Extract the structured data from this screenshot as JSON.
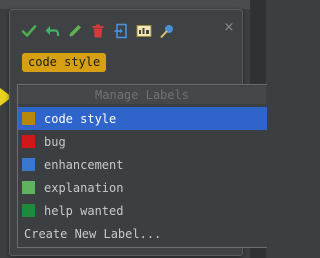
{
  "toolbar": {
    "icons": [
      {
        "name": "checkmark-icon",
        "color": "#4caf50"
      },
      {
        "name": "reply-icon",
        "color": "#45b06b"
      },
      {
        "name": "pencil-icon",
        "color": "#5fb34d"
      },
      {
        "name": "trash-icon",
        "color": "#d23b3b"
      },
      {
        "name": "export-icon",
        "color": "#4a90d9"
      },
      {
        "name": "text-label-icon",
        "color": "#d9c46a"
      },
      {
        "name": "pin-icon",
        "color": "#4a90d9"
      }
    ],
    "close": "×"
  },
  "active_tag": {
    "label": "code style",
    "color": "#d6a012"
  },
  "label_menu": {
    "title": "Manage Labels",
    "items": [
      {
        "label": "code style",
        "color": "#b8860b",
        "selected": true
      },
      {
        "label": "bug",
        "color": "#d11818",
        "selected": false
      },
      {
        "label": "enhancement",
        "color": "#3a78d0",
        "selected": false
      },
      {
        "label": "explanation",
        "color": "#5fb35f",
        "selected": false
      },
      {
        "label": "help wanted",
        "color": "#1e8a3c",
        "selected": false
      }
    ],
    "create_label": "Create New Label..."
  }
}
